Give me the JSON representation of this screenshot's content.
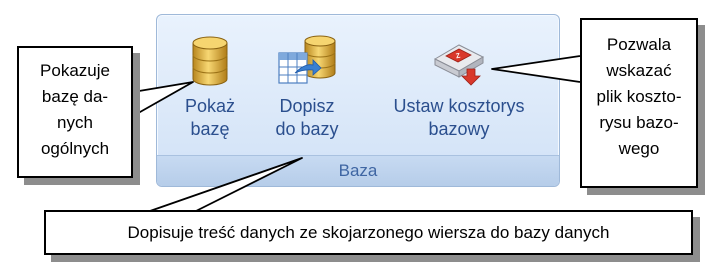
{
  "ribbon": {
    "group_label": "Baza",
    "buttons": [
      {
        "label": "Pokaż\nbazę",
        "icon": "database-icon"
      },
      {
        "label": "Dopisz\ndo bazy",
        "icon": "append-to-database-icon"
      },
      {
        "label": "Ustaw kosztorys\nbazowy",
        "icon": "set-base-estimate-icon"
      }
    ]
  },
  "callouts": {
    "left": "Pokazuje\nbazę da-\nnych\nogólnych",
    "right": "Pozwala\nwskazać\nplik koszto-\nrysu bazo-\nwego",
    "bottom": "Dopisuje treść danych ze skojarzonego wiersza do bazy danych"
  },
  "colors": {
    "ribbon_text": "#2b4f8e",
    "group_label_text": "#3f66a3",
    "database_gold": "#e4b43a",
    "book_red": "#d9382b"
  }
}
